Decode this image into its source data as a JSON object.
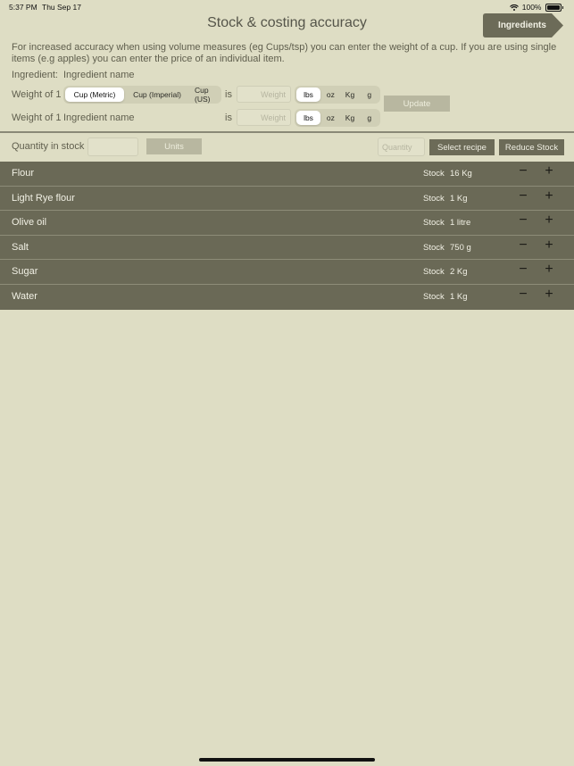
{
  "status": {
    "time": "5:37 PM",
    "date": "Thu Sep 17",
    "battery": "100%"
  },
  "title": "Stock & costing accuracy",
  "ingredients_tab": "Ingredients",
  "info_text": "For increased accuracy when using volume measures (eg Cups/tsp) you can enter the weight of a cup. If you are using single items (e.g apples) you can enter the price of an individual item.",
  "ingredient": {
    "label": "Ingredient:",
    "value": "Ingredient name"
  },
  "weight_row1": {
    "label": "Weight of 1",
    "cups": [
      "Cup (Metric)",
      "Cup (Imperial)",
      "Cup (US)"
    ],
    "cups_selected": "Cup (Metric)",
    "is": "is",
    "weight_placeholder": "Weight",
    "units": [
      "lbs",
      "oz",
      "Kg",
      "g"
    ],
    "units_selected": "lbs"
  },
  "weight_row2": {
    "label": "Weight of 1",
    "item": "Ingredient name",
    "is": "is",
    "weight_placeholder": "Weight",
    "units": [
      "lbs",
      "oz",
      "Kg",
      "g"
    ],
    "units_selected": "lbs"
  },
  "update_button": "Update",
  "stock_bar": {
    "label": "Quantity in stock",
    "units_button": "Units",
    "quantity_placeholder": "Quantity",
    "select_recipe": "Select recipe",
    "reduce_stock": "Reduce Stock"
  },
  "items": [
    {
      "name": "Flour",
      "stock_label": "Stock",
      "qty": "16 Kg",
      "minus": "−",
      "plus": "+"
    },
    {
      "name": "Light Rye flour",
      "stock_label": "Stock",
      "qty": "1 Kg",
      "minus": "−",
      "plus": "+"
    },
    {
      "name": "Olive oil",
      "stock_label": "Stock",
      "qty": "1 litre",
      "minus": "−",
      "plus": "+"
    },
    {
      "name": "Salt",
      "stock_label": "Stock",
      "qty": "750 g",
      "minus": "−",
      "plus": "+"
    },
    {
      "name": "Sugar",
      "stock_label": "Stock",
      "qty": "2 Kg",
      "minus": "−",
      "plus": "+"
    },
    {
      "name": "Water",
      "stock_label": "Stock",
      "qty": "1 Kg",
      "minus": "−",
      "plus": "+"
    }
  ],
  "colors": {
    "background": "#deddc4",
    "list_bg": "#6a6956",
    "dark_button": "#6c6b58",
    "disabled_button": "#b8b7a0"
  }
}
